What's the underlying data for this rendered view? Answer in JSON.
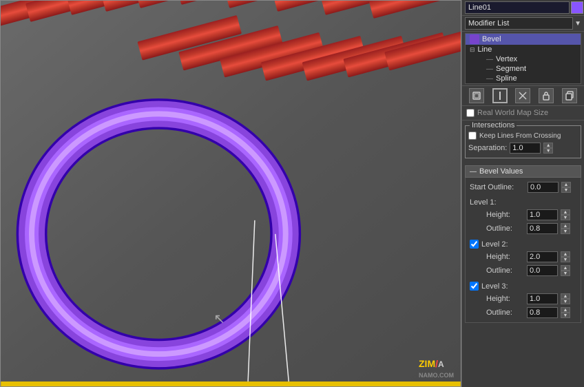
{
  "object_name": "Line01",
  "modifier_list_placeholder": "Modifier List",
  "stack": {
    "items": [
      {
        "label": "Bevel",
        "level": 0,
        "selected": true,
        "icon": "🔧"
      },
      {
        "label": "Line",
        "level": 0,
        "selected": false,
        "icon": "▤",
        "expand": true
      },
      {
        "label": "Vertex",
        "level": 1,
        "selected": false
      },
      {
        "label": "Segment",
        "level": 1,
        "selected": false
      },
      {
        "label": "Spline",
        "level": 1,
        "selected": false
      }
    ]
  },
  "toolbar": {
    "buttons": [
      "⊞",
      "|",
      "✕",
      "🔒",
      "📋"
    ]
  },
  "realworld": {
    "label": "Real World Map Size",
    "checked": false
  },
  "intersections": {
    "group_label": "Intersections",
    "keep_lines_label": "Keep Lines From Crossing",
    "keep_lines_checked": false,
    "separation_label": "Separation:",
    "separation_value": "1.0"
  },
  "bevel_values": {
    "section_label": "Bevel Values",
    "start_outline_label": "Start Outline:",
    "start_outline_value": "0.0",
    "level1": {
      "label": "Level 1:",
      "height_label": "Height:",
      "height_value": "1.0",
      "outline_label": "Outline:",
      "outline_value": "0.8",
      "checked": true
    },
    "level2": {
      "label": "Level 2:",
      "height_label": "Height:",
      "height_value": "2.0",
      "outline_label": "Outline:",
      "outline_value": "0.0",
      "checked": true
    },
    "level3": {
      "label": "Level 3:",
      "height_label": "Height:",
      "height_value": "1.0",
      "outline_label": "Outline:",
      "outline_value": "0.8",
      "checked": true
    }
  },
  "watermark": "NAMO.COM"
}
